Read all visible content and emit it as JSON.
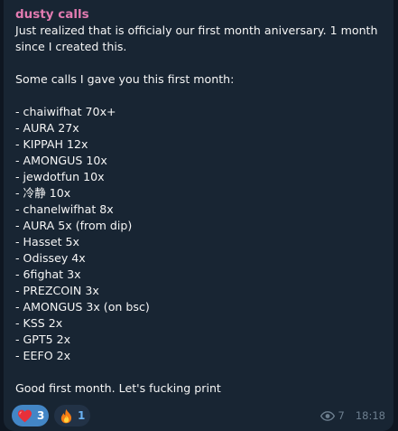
{
  "message": {
    "author": "dusty calls",
    "lines": [
      "Just realized that is officialy our first month aniversary. 1 month",
      "since I created this.",
      "",
      "Some calls I gave you this first month:",
      "",
      "- chaiwifhat 70x+",
      "- AURA 27x",
      "- KIPPAH 12x",
      "- AMONGUS 10x",
      "- jewdotfun 10x",
      "- 冷静 10x",
      "- chanelwifhat 8x",
      "- AURA 5x (from dip)",
      "- Hasset 5x",
      "- Odissey 4x",
      "- 6fighat 3x",
      "- PREZCOIN 3x",
      "- AMONGUS 3x (on bsc)",
      "- KSS 2x",
      "- GPT5 2x",
      "- EEFO 2x",
      "",
      "Good first month. Let's fucking print"
    ]
  },
  "reactions": [
    {
      "icon": "heart-icon",
      "count": "3",
      "active": true
    },
    {
      "icon": "fire-icon",
      "count": "1",
      "active": false
    }
  ],
  "meta": {
    "views_icon": "eye-icon",
    "views": "7",
    "time": "18:18"
  },
  "colors": {
    "author": "#e27bb1",
    "bubble": "#182533",
    "active_reaction": "#4386c6"
  }
}
